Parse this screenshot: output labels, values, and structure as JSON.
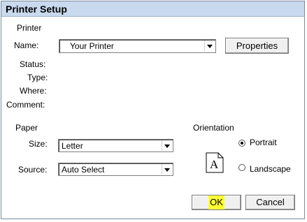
{
  "window": {
    "title": "Printer Setup"
  },
  "printer": {
    "group_label": "Printer",
    "name_label": "Name:",
    "name_value": "Your Printer",
    "properties_label": "Properties",
    "status_label": "Status:",
    "type_label": "Type:",
    "where_label": "Where:",
    "comment_label": "Comment:"
  },
  "paper": {
    "group_label": "Paper",
    "size_label": "Size:",
    "size_value": "Letter",
    "source_label": "Source:",
    "source_value": "Auto Select"
  },
  "orientation": {
    "group_label": "Orientation",
    "icon_letter": "A",
    "portrait_label": "Portrait",
    "landscape_label": "Landscape",
    "selected": "Portrait"
  },
  "buttons": {
    "ok_label": "OK",
    "cancel_label": "Cancel"
  },
  "colors": {
    "titlebar": "#c9d9ee",
    "ok_highlight": "#ffff33"
  }
}
